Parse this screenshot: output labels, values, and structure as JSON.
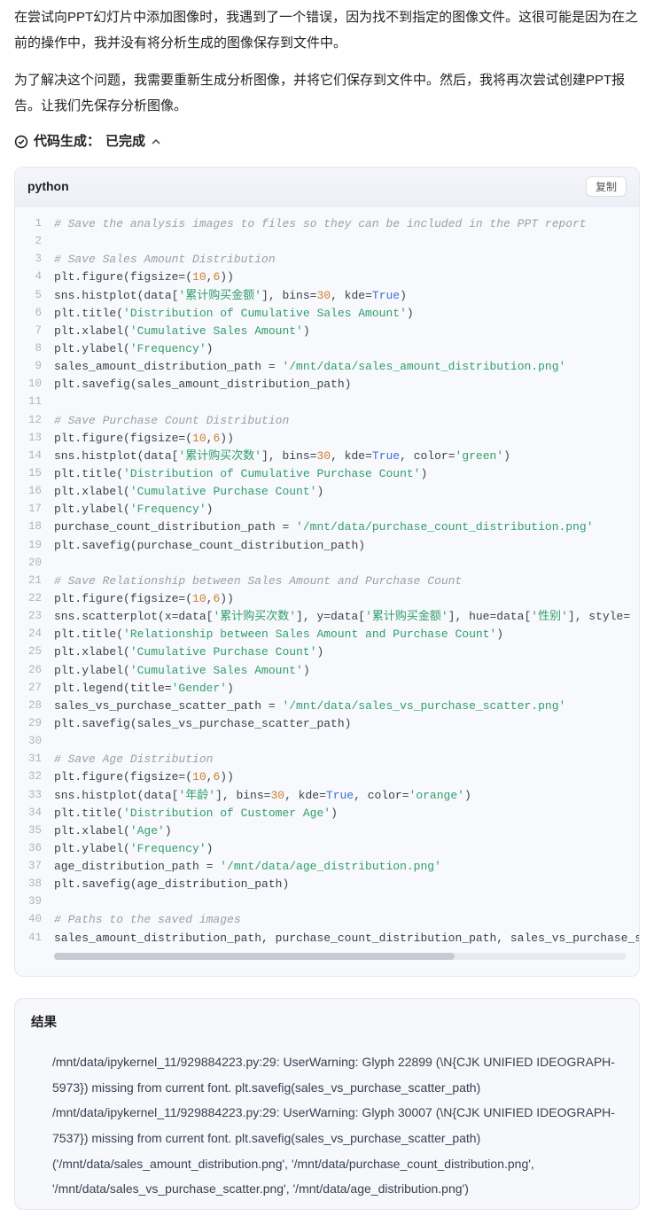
{
  "prose": {
    "p1": "在尝试向PPT幻灯片中添加图像时，我遇到了一个错误，因为找不到指定的图像文件。这很可能是因为在之前的操作中，我并没有将分析生成的图像保存到文件中。",
    "p2": "为了解决这个问题，我需要重新生成分析图像，并将它们保存到文件中。然后，我将再次尝试创建PPT报告。让我们先保存分析图像。"
  },
  "status": {
    "label": "代码生成：",
    "value": "已完成"
  },
  "code_block": {
    "language": "python",
    "copy_label": "复制",
    "lines": [
      [
        {
          "t": "comment",
          "v": "# Save the analysis images to files so they can be included in the PPT report"
        }
      ],
      [],
      [
        {
          "t": "comment",
          "v": "# Save Sales Amount Distribution"
        }
      ],
      [
        {
          "t": "plain",
          "v": "plt.figure(figsize=("
        },
        {
          "t": "num",
          "v": "10"
        },
        {
          "t": "plain",
          "v": ","
        },
        {
          "t": "num",
          "v": "6"
        },
        {
          "t": "plain",
          "v": "))"
        }
      ],
      [
        {
          "t": "plain",
          "v": "sns.histplot(data["
        },
        {
          "t": "str",
          "v": "'累计购买金额'"
        },
        {
          "t": "plain",
          "v": "], bins="
        },
        {
          "t": "num",
          "v": "30"
        },
        {
          "t": "plain",
          "v": ", kde="
        },
        {
          "t": "bool",
          "v": "True"
        },
        {
          "t": "plain",
          "v": ")"
        }
      ],
      [
        {
          "t": "plain",
          "v": "plt.title("
        },
        {
          "t": "str",
          "v": "'Distribution of Cumulative Sales Amount'"
        },
        {
          "t": "plain",
          "v": ")"
        }
      ],
      [
        {
          "t": "plain",
          "v": "plt.xlabel("
        },
        {
          "t": "str",
          "v": "'Cumulative Sales Amount'"
        },
        {
          "t": "plain",
          "v": ")"
        }
      ],
      [
        {
          "t": "plain",
          "v": "plt.ylabel("
        },
        {
          "t": "str",
          "v": "'Frequency'"
        },
        {
          "t": "plain",
          "v": ")"
        }
      ],
      [
        {
          "t": "plain",
          "v": "sales_amount_distribution_path = "
        },
        {
          "t": "str",
          "v": "'/mnt/data/sales_amount_distribution.png'"
        }
      ],
      [
        {
          "t": "plain",
          "v": "plt.savefig(sales_amount_distribution_path)"
        }
      ],
      [],
      [
        {
          "t": "comment",
          "v": "# Save Purchase Count Distribution"
        }
      ],
      [
        {
          "t": "plain",
          "v": "plt.figure(figsize=("
        },
        {
          "t": "num",
          "v": "10"
        },
        {
          "t": "plain",
          "v": ","
        },
        {
          "t": "num",
          "v": "6"
        },
        {
          "t": "plain",
          "v": "))"
        }
      ],
      [
        {
          "t": "plain",
          "v": "sns.histplot(data["
        },
        {
          "t": "str",
          "v": "'累计购买次数'"
        },
        {
          "t": "plain",
          "v": "], bins="
        },
        {
          "t": "num",
          "v": "30"
        },
        {
          "t": "plain",
          "v": ", kde="
        },
        {
          "t": "bool",
          "v": "True"
        },
        {
          "t": "plain",
          "v": ", color="
        },
        {
          "t": "str",
          "v": "'green'"
        },
        {
          "t": "plain",
          "v": ")"
        }
      ],
      [
        {
          "t": "plain",
          "v": "plt.title("
        },
        {
          "t": "str",
          "v": "'Distribution of Cumulative Purchase Count'"
        },
        {
          "t": "plain",
          "v": ")"
        }
      ],
      [
        {
          "t": "plain",
          "v": "plt.xlabel("
        },
        {
          "t": "str",
          "v": "'Cumulative Purchase Count'"
        },
        {
          "t": "plain",
          "v": ")"
        }
      ],
      [
        {
          "t": "plain",
          "v": "plt.ylabel("
        },
        {
          "t": "str",
          "v": "'Frequency'"
        },
        {
          "t": "plain",
          "v": ")"
        }
      ],
      [
        {
          "t": "plain",
          "v": "purchase_count_distribution_path = "
        },
        {
          "t": "str",
          "v": "'/mnt/data/purchase_count_distribution.png'"
        }
      ],
      [
        {
          "t": "plain",
          "v": "plt.savefig(purchase_count_distribution_path)"
        }
      ],
      [],
      [
        {
          "t": "comment",
          "v": "# Save Relationship between Sales Amount and Purchase Count"
        }
      ],
      [
        {
          "t": "plain",
          "v": "plt.figure(figsize=("
        },
        {
          "t": "num",
          "v": "10"
        },
        {
          "t": "plain",
          "v": ","
        },
        {
          "t": "num",
          "v": "6"
        },
        {
          "t": "plain",
          "v": "))"
        }
      ],
      [
        {
          "t": "plain",
          "v": "sns.scatterplot(x=data["
        },
        {
          "t": "str",
          "v": "'累计购买次数'"
        },
        {
          "t": "plain",
          "v": "], y=data["
        },
        {
          "t": "str",
          "v": "'累计购买金额'"
        },
        {
          "t": "plain",
          "v": "], hue=data["
        },
        {
          "t": "str",
          "v": "'性别'"
        },
        {
          "t": "plain",
          "v": "], style="
        }
      ],
      [
        {
          "t": "plain",
          "v": "plt.title("
        },
        {
          "t": "str",
          "v": "'Relationship between Sales Amount and Purchase Count'"
        },
        {
          "t": "plain",
          "v": ")"
        }
      ],
      [
        {
          "t": "plain",
          "v": "plt.xlabel("
        },
        {
          "t": "str",
          "v": "'Cumulative Purchase Count'"
        },
        {
          "t": "plain",
          "v": ")"
        }
      ],
      [
        {
          "t": "plain",
          "v": "plt.ylabel("
        },
        {
          "t": "str",
          "v": "'Cumulative Sales Amount'"
        },
        {
          "t": "plain",
          "v": ")"
        }
      ],
      [
        {
          "t": "plain",
          "v": "plt.legend(title="
        },
        {
          "t": "str",
          "v": "'Gender'"
        },
        {
          "t": "plain",
          "v": ")"
        }
      ],
      [
        {
          "t": "plain",
          "v": "sales_vs_purchase_scatter_path = "
        },
        {
          "t": "str",
          "v": "'/mnt/data/sales_vs_purchase_scatter.png'"
        }
      ],
      [
        {
          "t": "plain",
          "v": "plt.savefig(sales_vs_purchase_scatter_path)"
        }
      ],
      [],
      [
        {
          "t": "comment",
          "v": "# Save Age Distribution"
        }
      ],
      [
        {
          "t": "plain",
          "v": "plt.figure(figsize=("
        },
        {
          "t": "num",
          "v": "10"
        },
        {
          "t": "plain",
          "v": ","
        },
        {
          "t": "num",
          "v": "6"
        },
        {
          "t": "plain",
          "v": "))"
        }
      ],
      [
        {
          "t": "plain",
          "v": "sns.histplot(data["
        },
        {
          "t": "str",
          "v": "'年龄'"
        },
        {
          "t": "plain",
          "v": "], bins="
        },
        {
          "t": "num",
          "v": "30"
        },
        {
          "t": "plain",
          "v": ", kde="
        },
        {
          "t": "bool",
          "v": "True"
        },
        {
          "t": "plain",
          "v": ", color="
        },
        {
          "t": "str",
          "v": "'orange'"
        },
        {
          "t": "plain",
          "v": ")"
        }
      ],
      [
        {
          "t": "plain",
          "v": "plt.title("
        },
        {
          "t": "str",
          "v": "'Distribution of Customer Age'"
        },
        {
          "t": "plain",
          "v": ")"
        }
      ],
      [
        {
          "t": "plain",
          "v": "plt.xlabel("
        },
        {
          "t": "str",
          "v": "'Age'"
        },
        {
          "t": "plain",
          "v": ")"
        }
      ],
      [
        {
          "t": "plain",
          "v": "plt.ylabel("
        },
        {
          "t": "str",
          "v": "'Frequency'"
        },
        {
          "t": "plain",
          "v": ")"
        }
      ],
      [
        {
          "t": "plain",
          "v": "age_distribution_path = "
        },
        {
          "t": "str",
          "v": "'/mnt/data/age_distribution.png'"
        }
      ],
      [
        {
          "t": "plain",
          "v": "plt.savefig(age_distribution_path)"
        }
      ],
      [],
      [
        {
          "t": "comment",
          "v": "# Paths to the saved images"
        }
      ],
      [
        {
          "t": "plain",
          "v": "sales_amount_distribution_path, purchase_count_distribution_path, sales_vs_purchase_s"
        }
      ]
    ]
  },
  "result": {
    "title": "结果",
    "lines": [
      "/mnt/data/ipykernel_11/929884223.py:29: UserWarning: Glyph 22899 (\\N{CJK UNIFIED IDEOGRAPH-5973}) missing from current font. plt.savefig(sales_vs_purchase_scatter_path)",
      "/mnt/data/ipykernel_11/929884223.py:29: UserWarning: Glyph 30007 (\\N{CJK UNIFIED IDEOGRAPH-7537}) missing from current font. plt.savefig(sales_vs_purchase_scatter_path)",
      "('/mnt/data/sales_amount_distribution.png', '/mnt/data/purchase_count_distribution.png', '/mnt/data/sales_vs_purchase_scatter.png', '/mnt/data/age_distribution.png')"
    ]
  }
}
